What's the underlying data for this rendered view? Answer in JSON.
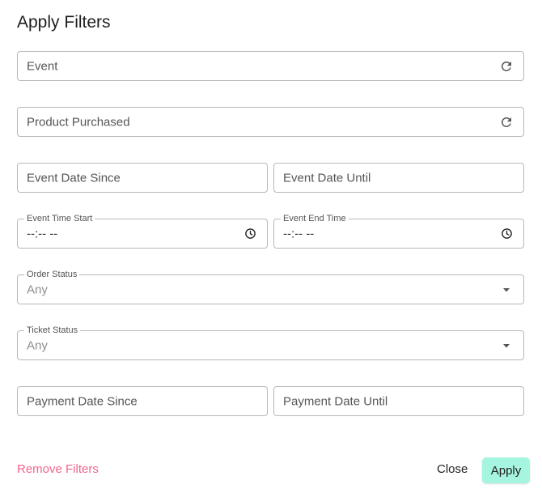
{
  "dialog": {
    "title": "Apply Filters"
  },
  "fields": {
    "event": {
      "placeholder": "Event",
      "icon": "refresh-icon"
    },
    "product": {
      "placeholder": "Product Purchased",
      "icon": "refresh-icon"
    },
    "event_date_since": {
      "placeholder": "Event Date Since"
    },
    "event_date_until": {
      "placeholder": "Event Date Until"
    },
    "event_time_start": {
      "label": "Event Time Start",
      "value": "--:-- --",
      "icon": "clock-icon"
    },
    "event_end_time": {
      "label": "Event End Time",
      "value": "--:-- --",
      "icon": "clock-icon"
    },
    "order_status": {
      "label": "Order Status",
      "value": "Any",
      "icon": "dropdown-arrow-icon"
    },
    "ticket_status": {
      "label": "Ticket Status",
      "value": "Any",
      "icon": "dropdown-arrow-icon"
    },
    "payment_date_since": {
      "placeholder": "Payment Date Since"
    },
    "payment_date_until": {
      "placeholder": "Payment Date Until"
    }
  },
  "actions": {
    "remove_label": "Remove Filters",
    "close_label": "Close",
    "apply_label": "Apply"
  },
  "colors": {
    "remove": "#f2668b",
    "apply_bg": "#a6f5e0",
    "border": "#b8b8b8"
  }
}
